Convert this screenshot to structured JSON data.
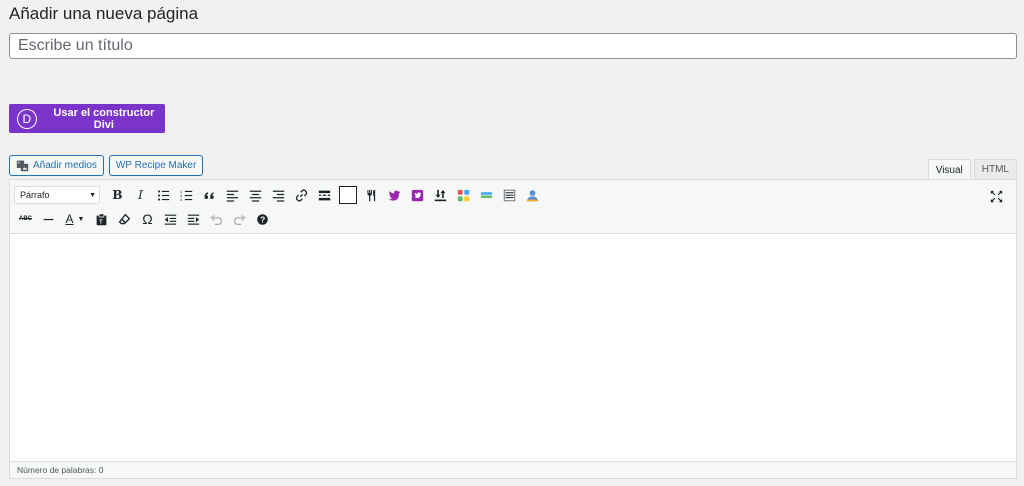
{
  "page": {
    "title": "Añadir una nueva página"
  },
  "title_field": {
    "placeholder": "Escribe un título",
    "value": ""
  },
  "divi": {
    "button_label": "Usar el constructor Divi",
    "logo_letter": "D",
    "color": "#7b34c9"
  },
  "media": {
    "add_media_label": "Añadir medios",
    "recipe_label": "WP Recipe Maker"
  },
  "tabs": [
    {
      "label": "Visual",
      "active": true
    },
    {
      "label": "HTML",
      "active": false
    }
  ],
  "toolbar": {
    "format_value": "Párrafo",
    "omega": "Ω",
    "text_color_letter": "A",
    "strike_letters": "ABC"
  },
  "status": {
    "word_count": "Número de palabras: 0"
  },
  "colors": {
    "accent": "#2271b1",
    "purple": "#7b34c9"
  }
}
